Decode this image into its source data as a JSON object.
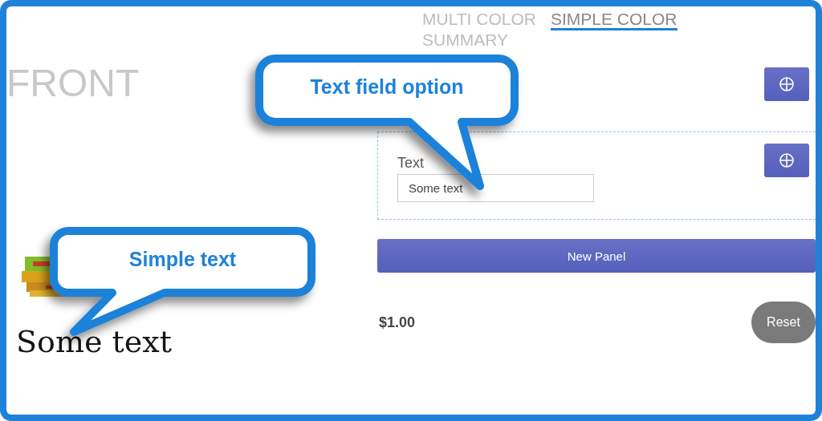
{
  "preview": {
    "side_label": "FRONT",
    "text": "Some text"
  },
  "tabs": [
    {
      "label": "MULTI COLOR",
      "selected": false
    },
    {
      "label": "SIMPLE COLOR",
      "selected": true
    },
    {
      "label": "SUMMARY",
      "selected": false
    }
  ],
  "fields": [
    {
      "label": "Text",
      "value": "Some text"
    }
  ],
  "new_panel_button": "New Panel",
  "price": "$1.00",
  "reset_button": "Reset",
  "callouts": [
    {
      "text": "Text field option"
    },
    {
      "text": "Simple text"
    }
  ]
}
